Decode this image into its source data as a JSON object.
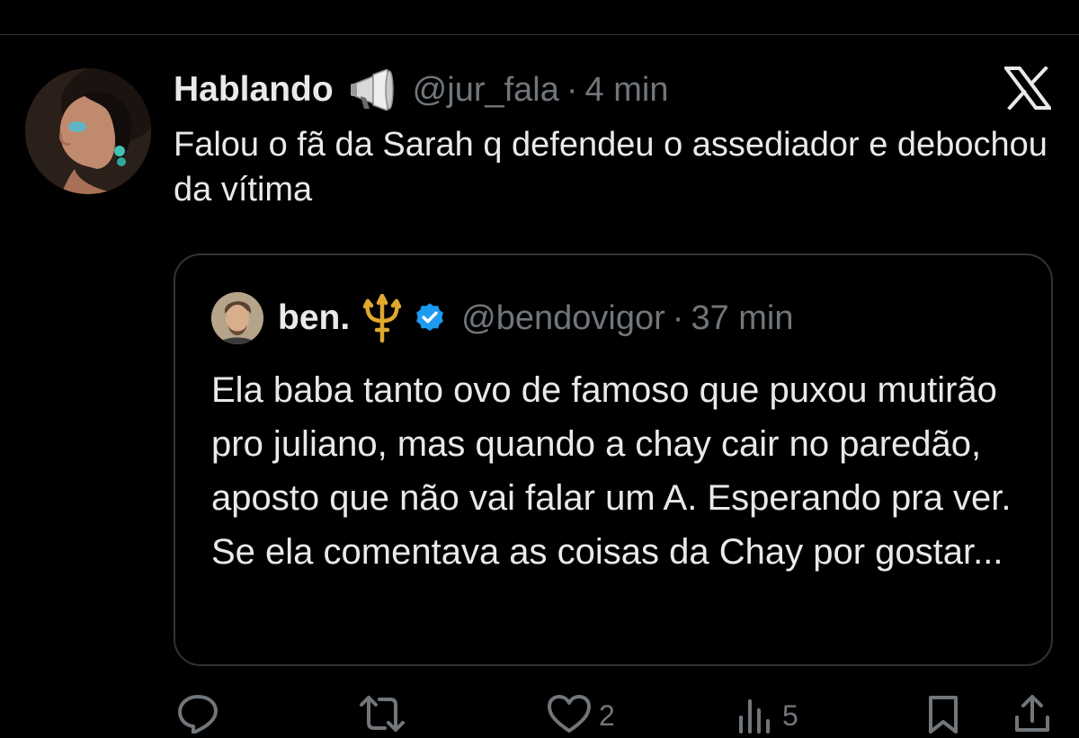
{
  "tweet": {
    "display_name": "Hablando",
    "name_emoji_icon": "megaphone-icon",
    "handle": "@jur_fala",
    "separator": "·",
    "time": "4 min",
    "text": "Falou o fã da Sarah q defendeu o assediador e debochou da vítima"
  },
  "quoted": {
    "display_name": "ben.",
    "name_emoji_icon": "trident-icon",
    "verified_icon": "verified-badge-icon",
    "handle": "@bendovigor",
    "separator": "·",
    "time": "37 min",
    "text": "Ela baba tanto ovo de famoso que puxou mutirão pro juliano, mas quando a chay cair no paredão, aposto que não vai falar um A. Esperando pra ver. Se ela comentava as coisas da Chay por gostar..."
  },
  "actions": {
    "reply_icon": "reply-icon",
    "retweet_icon": "retweet-icon",
    "like_icon": "heart-icon",
    "like_count": "2",
    "views_icon": "views-icon",
    "views_count": "5",
    "bookmark_icon": "bookmark-icon",
    "share_icon": "share-icon"
  },
  "colors": {
    "background": "#000000",
    "text_primary": "#e7e9ea",
    "text_secondary": "#71767b",
    "border": "#2f3336",
    "verified": "#1d9bf0",
    "trident": "#e0a82e"
  }
}
